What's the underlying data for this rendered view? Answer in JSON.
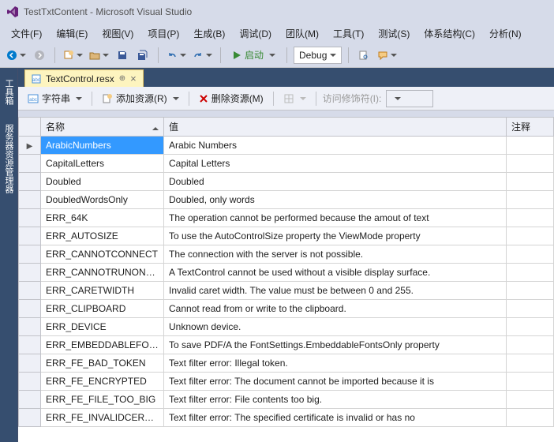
{
  "titlebar": {
    "title": "TestTxtContent - Microsoft Visual Studio"
  },
  "menu": {
    "file": "文件(F)",
    "edit": "编辑(E)",
    "view": "视图(V)",
    "project": "项目(P)",
    "build": "生成(B)",
    "debug": "调试(D)",
    "team": "团队(M)",
    "tools": "工具(T)",
    "test": "测试(S)",
    "arch": "体系结构(C)",
    "analyze": "分析(N)"
  },
  "toolbar": {
    "start": "启动",
    "config": "Debug"
  },
  "sidebar": {
    "toolbox": "工具箱",
    "explorer": "服务器资源管理器"
  },
  "tab": {
    "label": "TextControl.resx"
  },
  "resbar": {
    "strings": "字符串",
    "add": "添加资源(R)",
    "remove": "删除资源(M)",
    "access": "访问修饰符(I):"
  },
  "grid": {
    "headers": {
      "name": "名称",
      "value": "值",
      "comment": "注释"
    },
    "rows": [
      {
        "name": "ArabicNumbers",
        "value": "Arabic Numbers",
        "selected": true
      },
      {
        "name": "CapitalLetters",
        "value": "Capital Letters"
      },
      {
        "name": "Doubled",
        "value": "Doubled"
      },
      {
        "name": "DoubledWordsOnly",
        "value": "Doubled, only words"
      },
      {
        "name": "ERR_64K",
        "value": "The operation cannot be performed because the amout of text"
      },
      {
        "name": "ERR_AUTOSIZE",
        "value": "To use the AutoControlSize property the ViewMode property"
      },
      {
        "name": "ERR_CANNOTCONNECT",
        "value": "The connection with the server is not possible."
      },
      {
        "name": "ERR_CANNOTRUNONSER",
        "value": "A TextControl cannot be used without a visible display surface."
      },
      {
        "name": "ERR_CARETWIDTH",
        "value": "Invalid caret width. The value must be between 0 and 255."
      },
      {
        "name": "ERR_CLIPBOARD",
        "value": "Cannot read from or write to the clipboard."
      },
      {
        "name": "ERR_DEVICE",
        "value": "Unknown device."
      },
      {
        "name": "ERR_EMBEDDABLEFONTS",
        "value": "To save PDF/A the FontSettings.EmbeddableFontsOnly property"
      },
      {
        "name": "ERR_FE_BAD_TOKEN",
        "value": "Text filter error: Illegal token."
      },
      {
        "name": "ERR_FE_ENCRYPTED",
        "value": "Text filter error: The document cannot be imported because it is"
      },
      {
        "name": "ERR_FE_FILE_TOO_BIG",
        "value": "Text filter error: File contents too big."
      },
      {
        "name": "ERR_FE_INVALIDCERTIFICA",
        "value": "Text filter error: The specified certificate is invalid or has no"
      }
    ]
  }
}
